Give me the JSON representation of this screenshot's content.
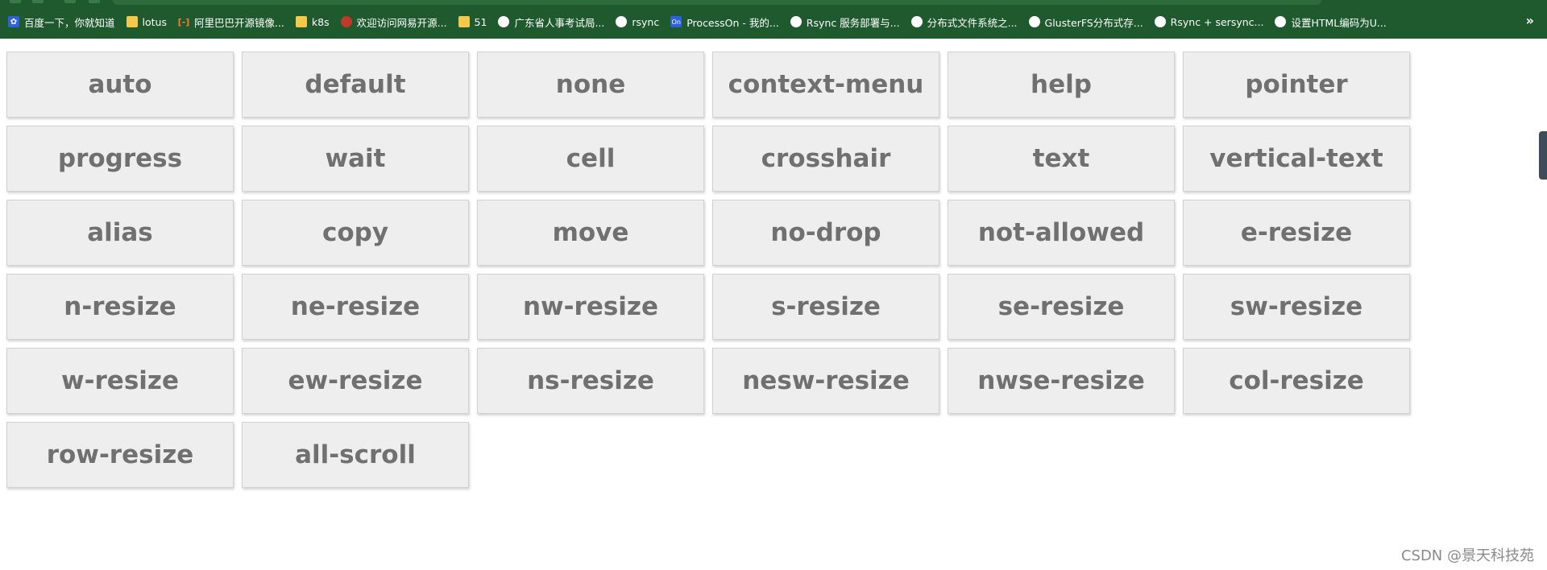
{
  "bookmarks": [
    {
      "label": "百度一下，你就知道",
      "icon": "baidu-icon"
    },
    {
      "label": "lotus",
      "icon": "folder-icon"
    },
    {
      "label": "阿里巴巴开源镜像...",
      "icon": "aliyun-icon"
    },
    {
      "label": "k8s",
      "icon": "folder-icon"
    },
    {
      "label": "欢迎访问网易开源...",
      "icon": "netease-icon"
    },
    {
      "label": "51",
      "icon": "folder-icon"
    },
    {
      "label": "广东省人事考试局...",
      "icon": "globe-icon"
    },
    {
      "label": "rsync",
      "icon": "globe-icon"
    },
    {
      "label": "ProcessOn - 我的...",
      "icon": "processon-icon"
    },
    {
      "label": "Rsync 服务部署与...",
      "icon": "globe-icon"
    },
    {
      "label": "分布式文件系统之...",
      "icon": "globe-icon"
    },
    {
      "label": "GlusterFS分布式存...",
      "icon": "globe-icon"
    },
    {
      "label": "Rsync + sersync...",
      "icon": "globe-icon"
    },
    {
      "label": "设置HTML编码为U...",
      "icon": "globe-icon"
    }
  ],
  "overflow_label": "»",
  "cursors": [
    "auto",
    "default",
    "none",
    "context-menu",
    "help",
    "pointer",
    "progress",
    "wait",
    "cell",
    "crosshair",
    "text",
    "vertical-text",
    "alias",
    "copy",
    "move",
    "no-drop",
    "not-allowed",
    "e-resize",
    "n-resize",
    "ne-resize",
    "nw-resize",
    "s-resize",
    "se-resize",
    "sw-resize",
    "w-resize",
    "ew-resize",
    "ns-resize",
    "nesw-resize",
    "nwse-resize",
    "col-resize",
    "row-resize",
    "all-scroll"
  ],
  "watermark": "CSDN @景天科技苑",
  "colors": {
    "bookmark_bar": "#1f5a2e",
    "cell_background": "#eeeeee",
    "cell_text": "#707070"
  }
}
